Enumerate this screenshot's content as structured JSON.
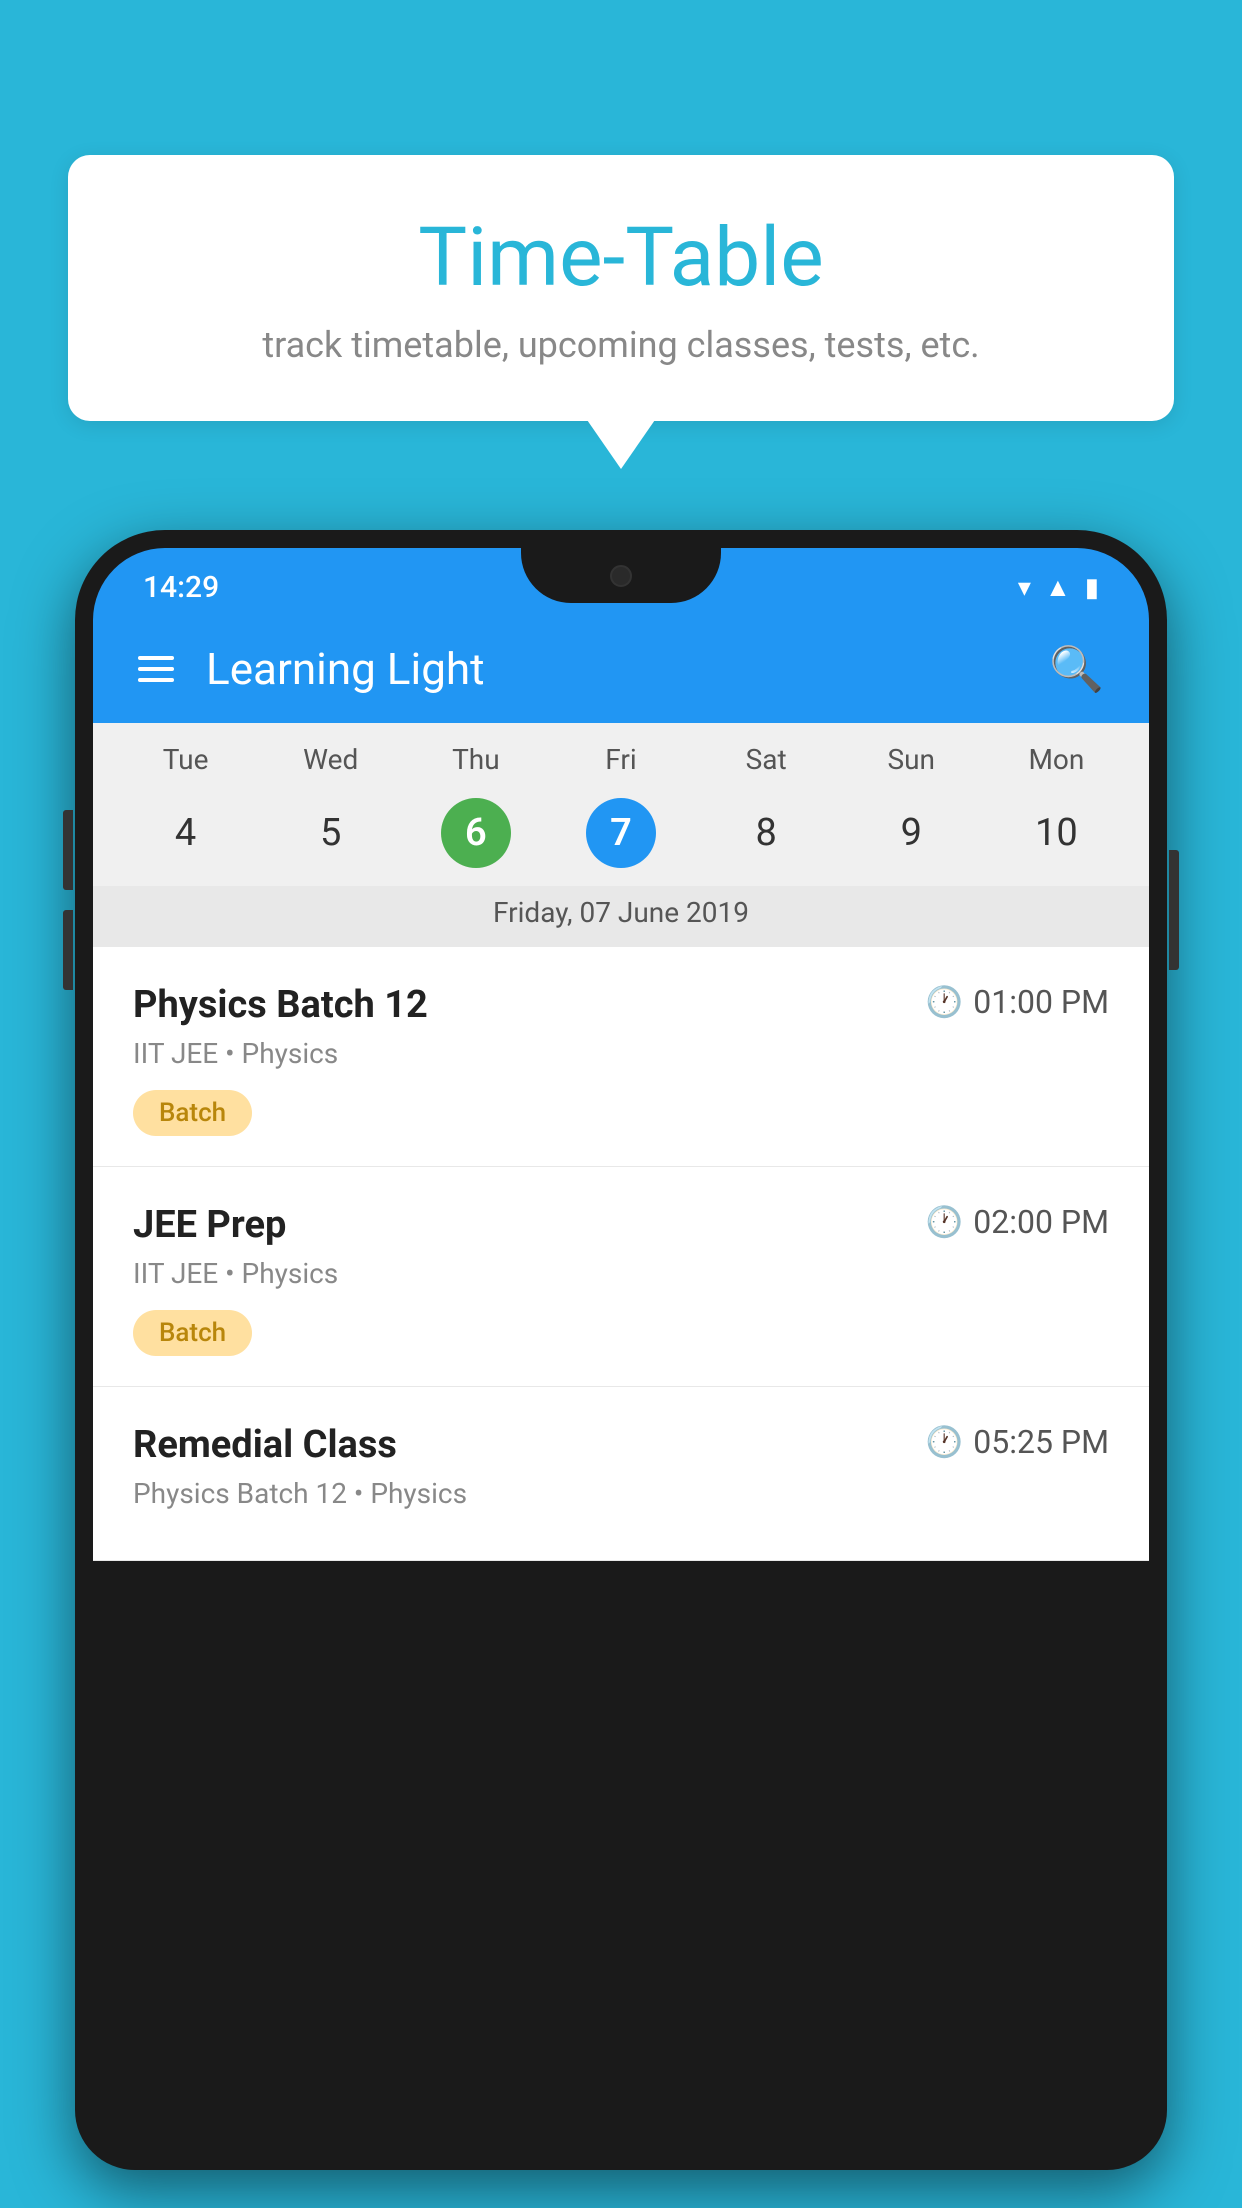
{
  "background_color": "#29b6d8",
  "bubble": {
    "title": "Time-Table",
    "subtitle": "track timetable, upcoming classes, tests, etc."
  },
  "phone": {
    "status_bar": {
      "time": "14:29"
    },
    "app_bar": {
      "title": "Learning Light"
    },
    "calendar": {
      "days": [
        "Tue",
        "Wed",
        "Thu",
        "Fri",
        "Sat",
        "Sun",
        "Mon"
      ],
      "dates": [
        "4",
        "5",
        "6",
        "7",
        "8",
        "9",
        "10"
      ],
      "today_index": 2,
      "selected_index": 3,
      "selected_label": "Friday, 07 June 2019"
    },
    "schedule": [
      {
        "title": "Physics Batch 12",
        "time": "01:00 PM",
        "subtitle": "IIT JEE • Physics",
        "badge": "Batch"
      },
      {
        "title": "JEE Prep",
        "time": "02:00 PM",
        "subtitle": "IIT JEE • Physics",
        "badge": "Batch"
      },
      {
        "title": "Remedial Class",
        "time": "05:25 PM",
        "subtitle": "Physics Batch 12 • Physics",
        "badge": null
      }
    ]
  }
}
